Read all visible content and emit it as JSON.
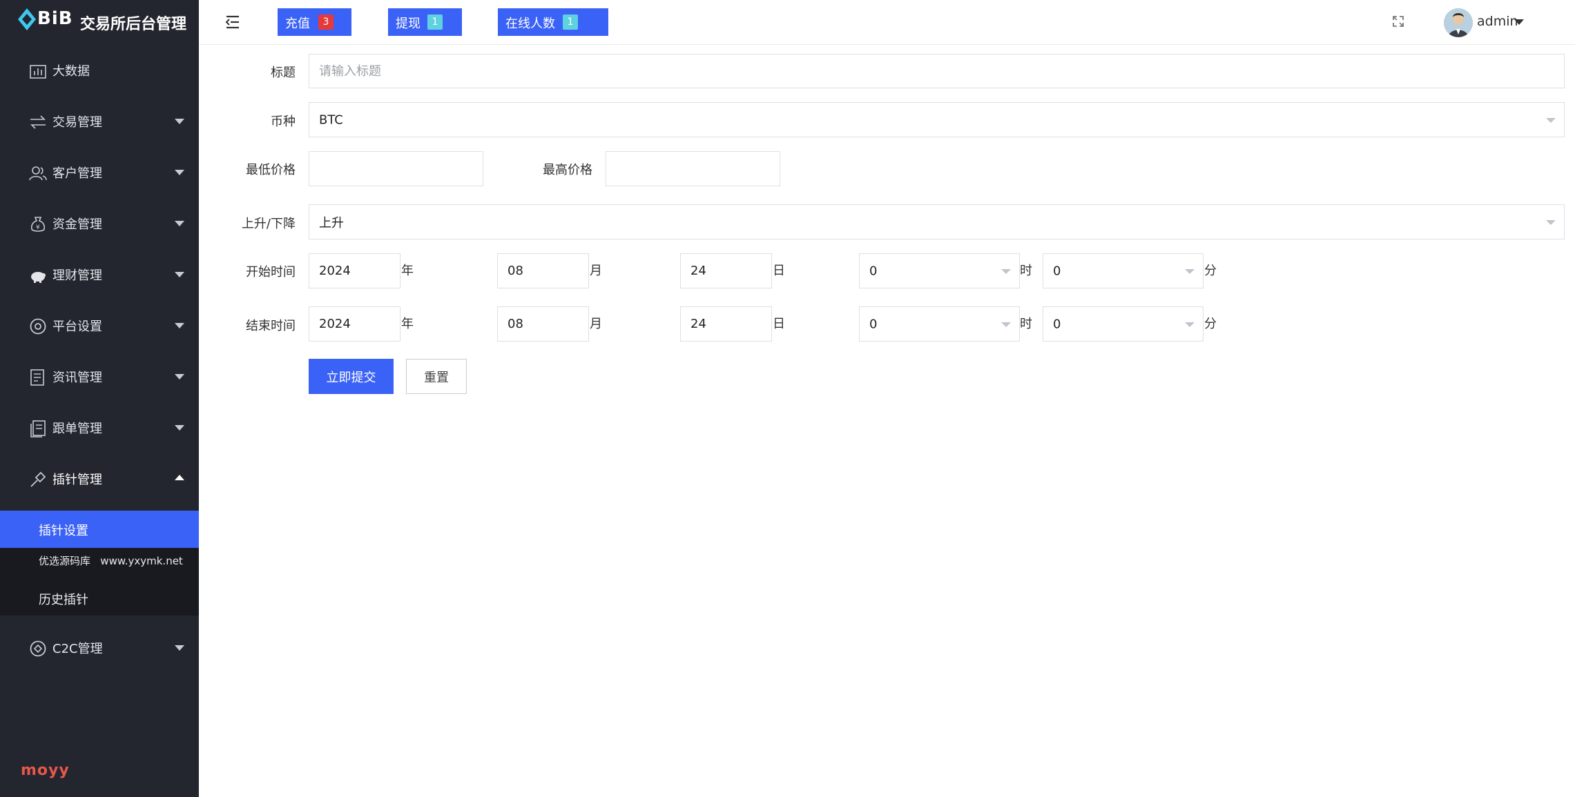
{
  "sidebar": {
    "logo_text": "BiB",
    "app_title": "交易所后台管理",
    "items": [
      {
        "label": "大数据",
        "icon": "chart-icon"
      },
      {
        "label": "交易管理",
        "icon": "exchange-icon"
      },
      {
        "label": "客户管理",
        "icon": "users-icon"
      },
      {
        "label": "资金管理",
        "icon": "money-bag-icon"
      },
      {
        "label": "理财管理",
        "icon": "piggy-bank-icon"
      },
      {
        "label": "平台设置",
        "icon": "settings-icon"
      },
      {
        "label": "资讯管理",
        "icon": "news-icon"
      },
      {
        "label": "跟单管理",
        "icon": "document-icon"
      },
      {
        "label": "插针管理",
        "icon": "pin-icon"
      },
      {
        "label": "C2C管理",
        "icon": "c2c-icon"
      }
    ],
    "subitems": [
      {
        "label": "插针设置"
      },
      {
        "label": "优选源码库   www.yxymk.net"
      },
      {
        "label": "历史插针"
      }
    ],
    "watermark": "moyy"
  },
  "header": {
    "buttons": [
      {
        "label": "充值",
        "badge": "3"
      },
      {
        "label": "提现",
        "badge": "1"
      },
      {
        "label": "在线人数",
        "badge": "1"
      }
    ],
    "user": "admin"
  },
  "form": {
    "title_label": "标题",
    "title_placeholder": "请输入标题",
    "coin_label": "币种",
    "coin_value": "BTC",
    "min_price_label": "最低价格",
    "max_price_label": "最高价格",
    "direction_label": "上升/下降",
    "direction_value": "上升",
    "start_label": "开始时间",
    "end_label": "结束时间",
    "start": {
      "year": "2024",
      "month": "08",
      "day": "24",
      "hour": "0",
      "minute": "0"
    },
    "end": {
      "year": "2024",
      "month": "08",
      "day": "24",
      "hour": "0",
      "minute": "0"
    },
    "units": {
      "year": "年",
      "month": "月",
      "day": "日",
      "hour": "时",
      "minute": "分"
    },
    "submit_label": "立即提交",
    "reset_label": "重置"
  },
  "colors": {
    "accent": "#3b62f6",
    "sidebar_bg": "#23262e",
    "badge_red": "#e5393b",
    "badge_cyan": "#5fd2e0"
  }
}
